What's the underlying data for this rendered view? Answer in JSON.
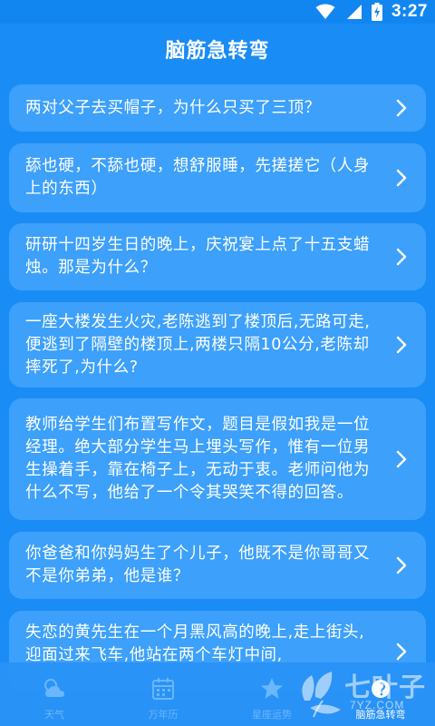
{
  "status_bar": {
    "time": "3:27",
    "icons": [
      "wifi-icon",
      "signal-icon",
      "battery-charging-icon"
    ]
  },
  "header": {
    "title": "脑筋急转弯"
  },
  "riddles": [
    {
      "text": "两对父子去买帽子，为什么只买了三顶？"
    },
    {
      "text": "舔也硬，不舔也硬，想舒服睡，先搓搓它（人身上的东西）"
    },
    {
      "text": "研研十四岁生日的晚上，庆祝宴上点了十五支蜡烛。那是为什么？"
    },
    {
      "text": "一座大楼发生火灾,老陈逃到了楼顶后,无路可走,便逃到了隔壁的楼顶上,两楼只隔10公分,老陈却摔死了,为什么?"
    },
    {
      "text": "教师给学生们布置写作文，题目是假如我是一位经理。绝大部分学生马上埋头写作，惟有一位男生操着手，靠在椅子上，无动于衷。老师问他为什么不写，他给了一个令其哭笑不得的回答。"
    },
    {
      "text": "你爸爸和你妈妈生了个儿子，他既不是你哥哥又不是你弟弟，他是谁？"
    },
    {
      "text": "失恋的黄先生在一个月黑风高的晚上,走上街头,迎面过来飞车,他站在两个车灯中间,"
    }
  ],
  "bottom_nav": {
    "items": [
      {
        "label": "天气",
        "icon": "weather-icon",
        "active": false
      },
      {
        "label": "万年历",
        "icon": "calendar-icon",
        "active": false
      },
      {
        "label": "星座运势",
        "icon": "star-icon",
        "active": false
      },
      {
        "label": "脑筋急转弯",
        "icon": "brain-teaser-icon",
        "active": true
      }
    ]
  },
  "watermark": {
    "brand": "七叶子",
    "url": "7YZ.COM"
  },
  "colors": {
    "background": "#1a8cf5",
    "card": "#3da0fb",
    "nav_inactive_label": "#6cb8ff",
    "text": "#ffffff"
  }
}
